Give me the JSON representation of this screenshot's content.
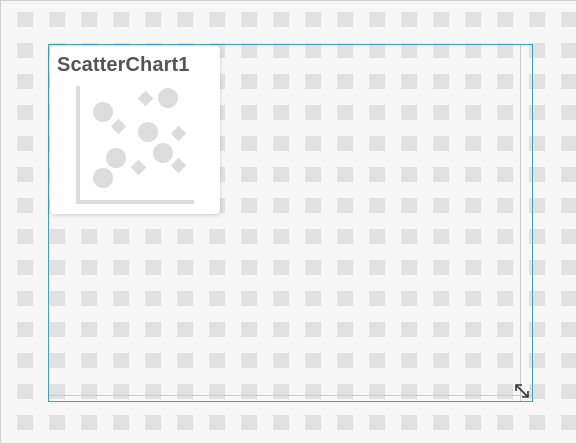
{
  "widget": {
    "title": "ScatterChart1",
    "icon": "scatter-chart-icon",
    "accent_color": "#3aa4c2"
  },
  "resize_handle": {
    "icon": "resize-diagonal-icon"
  }
}
